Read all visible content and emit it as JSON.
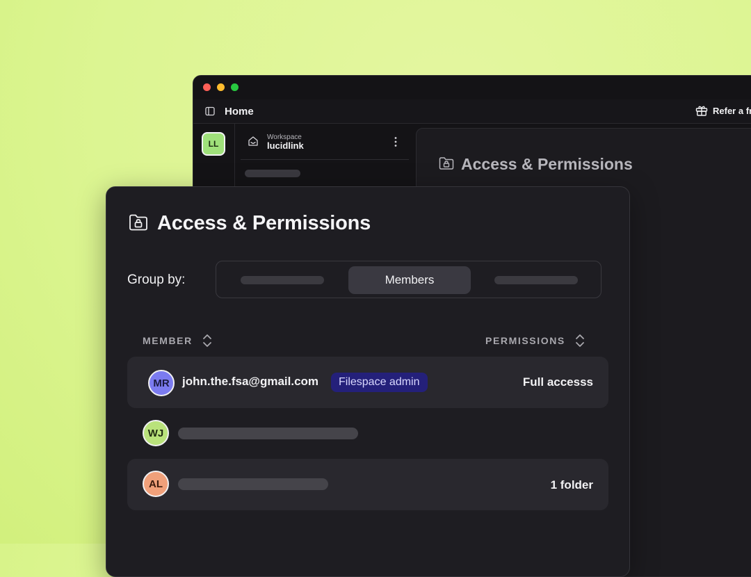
{
  "window": {
    "title": "Home",
    "refer_label": "Refer a fr",
    "workspace_label": "Workspace",
    "workspace_name": "lucidlink",
    "workspace_avatar": "LL"
  },
  "back_panel": {
    "title": "Access & Permissions"
  },
  "card": {
    "title": "Access & Permissions",
    "group_by_label": "Group by:",
    "group_by_options": {
      "active": "Members"
    },
    "columns": {
      "member": "MEMBER",
      "permissions": "PERMISSIONS"
    },
    "rows": [
      {
        "initials": "MR",
        "email": "john.the.fsa@gmail.com",
        "badge": "Filespace admin",
        "permission": "Full accesss",
        "avatar_color": "#7b7bf0"
      },
      {
        "initials": "WJ",
        "email": "",
        "badge": "",
        "permission": "",
        "avatar_color": "#b9e27b"
      },
      {
        "initials": "AL",
        "email": "",
        "badge": "",
        "permission": "1 folder",
        "avatar_color": "#f0a07a"
      }
    ]
  },
  "colors": {
    "accent_green": "#9fe07a",
    "badge_bg": "#24207a",
    "background": "#dcf592"
  },
  "icons": [
    "sidebar-toggle-icon",
    "gift-icon",
    "workspace-icon",
    "more-vertical-icon",
    "folder-lock-icon",
    "sort-icon"
  ]
}
